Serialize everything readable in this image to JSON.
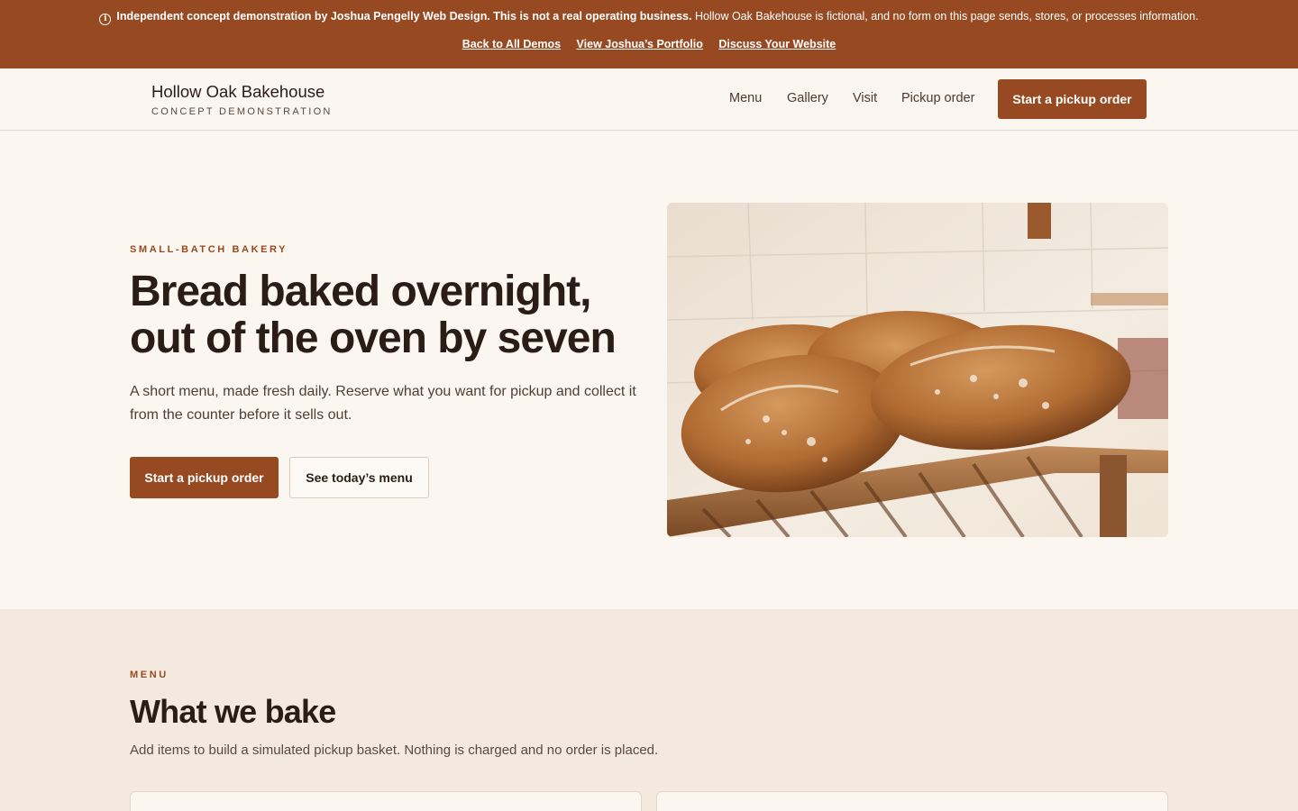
{
  "demo_banner": {
    "notice_bold": "Independent concept demonstration by Joshua Pengelly Web Design. This is not a real operating business.",
    "notice_rest": "Hollow Oak Bakehouse is fictional, and no form on this page sends, stores, or processes information.",
    "links": [
      "Back to All Demos",
      "View Joshua’s Portfolio",
      "Discuss Your Website"
    ]
  },
  "header": {
    "brand": "Hollow Oak Bakehouse",
    "tagline": "CONCEPT DEMONSTRATION",
    "nav": [
      "Menu",
      "Gallery",
      "Visit",
      "Pickup order"
    ],
    "cta": "Start a pickup order"
  },
  "hero": {
    "eyebrow": "SMALL-BATCH BAKERY",
    "title_line1": "Bread baked overnight,",
    "title_line2": "out of the oven by seven",
    "subtitle": "A short menu, made fresh daily. Reserve what you want for pickup and collect it from the counter before it sells out.",
    "primary_cta": "Start a pickup order",
    "secondary_cta": "See today’s menu"
  },
  "menu": {
    "eyebrow": "MENU",
    "title": "What we bake",
    "subtitle": "Add items to build a simulated pickup basket. Nothing is charged and no order is placed."
  },
  "colors": {
    "accent": "#974a22",
    "page_bg": "#fbf6ef",
    "section_bg": "#f3e9de",
    "text": "#2a1d16"
  }
}
